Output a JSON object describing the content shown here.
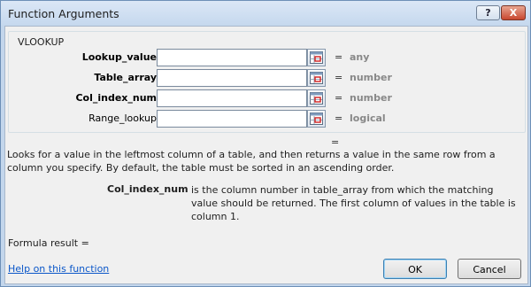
{
  "window": {
    "title": "Function Arguments"
  },
  "titlebar": {
    "help_glyph": "?",
    "close_glyph": "X"
  },
  "function": {
    "name": "VLOOKUP"
  },
  "arguments": [
    {
      "label": "Lookup_value",
      "bold": true,
      "value": "",
      "result": "any"
    },
    {
      "label": "Table_array",
      "bold": true,
      "value": "",
      "result": "number"
    },
    {
      "label": "Col_index_num",
      "bold": true,
      "value": "",
      "result": "number"
    },
    {
      "label": "Range_lookup",
      "bold": false,
      "value": "",
      "result": "logical"
    }
  ],
  "equals_sign": "=",
  "description": "Looks for a value in the leftmost column of a table, and then returns a value in the same row from a column you specify. By default, the table must be sorted in an ascending order.",
  "argument_help": {
    "name": "Col_index_num",
    "text": "is the column number in table_array from which the matching value should be returned. The first column of values in the table is column 1."
  },
  "formula_result": {
    "label": "Formula result ="
  },
  "footer": {
    "help_link": "Help on this function",
    "ok_label": "OK",
    "cancel_label": "Cancel"
  },
  "colors": {
    "link": "#0b57c9",
    "result_text": "#888888",
    "title_bar": "#c3d6ec"
  }
}
